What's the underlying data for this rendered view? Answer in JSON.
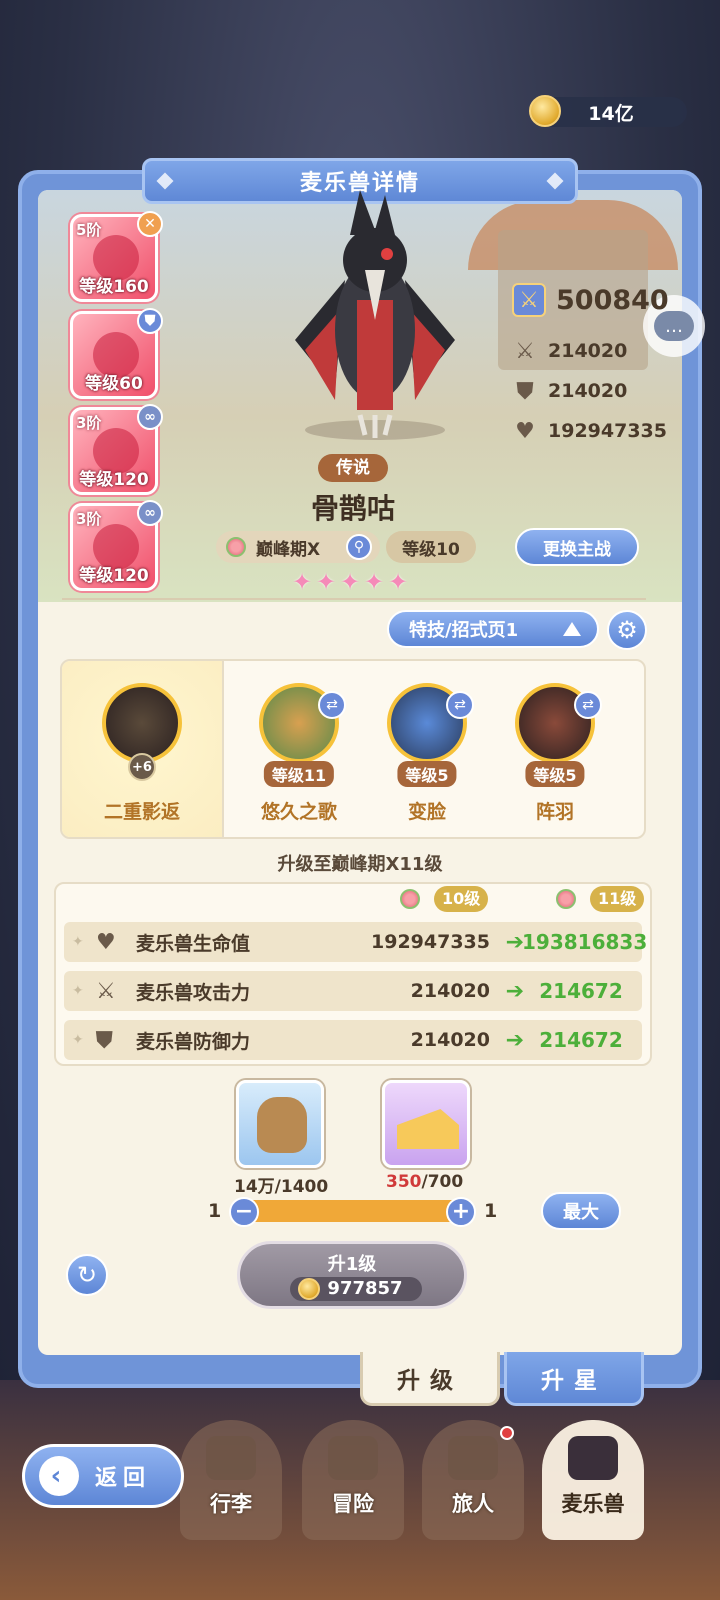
{
  "currency": {
    "amount": "14亿",
    "icon": "gold-coin-icon"
  },
  "panel_title": "麦乐兽详情",
  "team": [
    {
      "tier": "5阶",
      "level": "等级160",
      "badge": "close",
      "badge_color": "#f0a050"
    },
    {
      "tier": "",
      "level": "等级60",
      "badge": "shield",
      "badge_color": "#6a8ad8"
    },
    {
      "tier": "3阶",
      "level": "等级120",
      "badge": "link",
      "badge_color": "#7a90c8"
    },
    {
      "tier": "3阶",
      "level": "等级120",
      "badge": "link",
      "badge_color": "#7a90c8"
    }
  ],
  "stats": {
    "power": "500840",
    "attack": "214020",
    "defense": "214020",
    "hp": "192947335"
  },
  "pet": {
    "rarity": "传说",
    "name": "骨鹊咕",
    "stage": "巅峰期X",
    "level": "等级10",
    "stars": 5
  },
  "buttons": {
    "change_main": "更换主战",
    "skill_page": "特技/招式页1",
    "max": "最大",
    "back": "返回"
  },
  "skills": [
    {
      "name": "二重影返",
      "level": "",
      "bonus": "+6",
      "selected": true
    },
    {
      "name": "悠久之歌",
      "level": "等级11",
      "bonus": "",
      "selected": false
    },
    {
      "name": "变脸",
      "level": "等级5",
      "bonus": "",
      "selected": false
    },
    {
      "name": "阵羽",
      "level": "等级5",
      "bonus": "",
      "selected": false
    }
  ],
  "upgrade": {
    "title": "升级至巅峰期X11级",
    "from_level": "10级",
    "to_level": "11级",
    "rows": [
      {
        "icon": "heart-icon",
        "label": "麦乐兽生命值",
        "current": "192947335",
        "next": "193816833"
      },
      {
        "icon": "swords-icon",
        "label": "麦乐兽攻击力",
        "current": "214020",
        "next": "214672"
      },
      {
        "icon": "shield-icon",
        "label": "麦乐兽防御力",
        "current": "214020",
        "next": "214672"
      }
    ]
  },
  "materials": [
    {
      "name": "food-bag",
      "have": "14万",
      "need": "/1400"
    },
    {
      "name": "cheese",
      "have": "350",
      "need": "/700"
    }
  ],
  "slider": {
    "min": "1",
    "max": "1"
  },
  "level_up": {
    "label": "升1级",
    "cost": "977857"
  },
  "tabs": {
    "upgrade": "升级",
    "star": "升星"
  },
  "nav": [
    {
      "label": "行李",
      "active": false,
      "dot": false
    },
    {
      "label": "冒险",
      "active": false,
      "dot": false
    },
    {
      "label": "旅人",
      "active": false,
      "dot": true
    },
    {
      "label": "麦乐兽",
      "active": true,
      "dot": false
    }
  ],
  "colors": {
    "accent_blue": "#5d86d6",
    "green": "#4caf3a",
    "brown": "#a6663a",
    "pink": "#f04f6a"
  }
}
